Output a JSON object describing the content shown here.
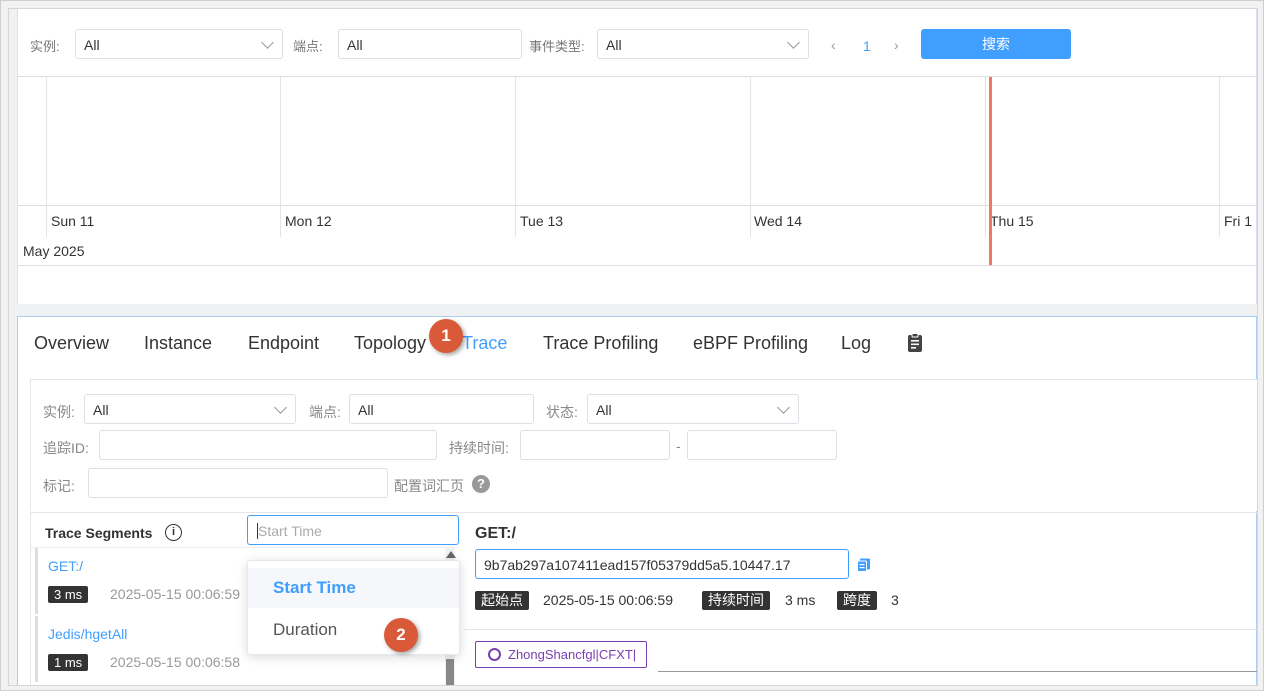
{
  "top_filters": {
    "instance_label": "实例:",
    "instance_value": "All",
    "endpoint_label": "端点:",
    "endpoint_value": "All",
    "event_type_label": "事件类型:",
    "event_type_value": "All",
    "page": "1",
    "search_label": "搜索"
  },
  "timeline": {
    "days": [
      "Sun 11",
      "Mon 12",
      "Tue 13",
      "Wed 14",
      "Thu 15",
      "Fri 1"
    ],
    "month": "May 2025",
    "now_color": "#ee7a5e"
  },
  "tabs": [
    {
      "label": "Overview"
    },
    {
      "label": "Instance"
    },
    {
      "label": "Endpoint"
    },
    {
      "label": "Topology"
    },
    {
      "label": "Trace"
    },
    {
      "label": "Trace Profiling"
    },
    {
      "label": "eBPF Profiling"
    },
    {
      "label": "Log"
    }
  ],
  "active_tab": "Trace",
  "callouts": [
    "1",
    "2"
  ],
  "trace_filters": {
    "instance_label": "实例:",
    "instance_value": "All",
    "endpoint_label": "端点:",
    "endpoint_value": "All",
    "status_label": "状态:",
    "status_value": "All",
    "trace_id_label": "追踪ID:",
    "duration_label": "持续时间:",
    "duration_sep": "-",
    "tags_label": "标记:",
    "tags_vocab_label": "配置词汇页"
  },
  "segments": {
    "title": "Trace Segments",
    "sort_placeholder": "Start Time",
    "sort_options": [
      "Start Time",
      "Duration"
    ],
    "selected_option": "Start Time",
    "items": [
      {
        "name": "GET:/",
        "duration": "3 ms",
        "time": "2025-05-15 00:06:59"
      },
      {
        "name": "Jedis/hgetAll",
        "duration": "1 ms",
        "time": "2025-05-15 00:06:58"
      }
    ]
  },
  "detail": {
    "title": "GET:/",
    "trace_id": "9b7ab297a107411ead157f05379dd5a5.10447.17",
    "start_label": "起始点",
    "start_value": "2025-05-15 00:06:59",
    "duration_label": "持续时间",
    "duration_value": "3 ms",
    "span_label": "跨度",
    "span_value": "3",
    "service_tag": "ZhongShancfgl|CFXT|"
  }
}
